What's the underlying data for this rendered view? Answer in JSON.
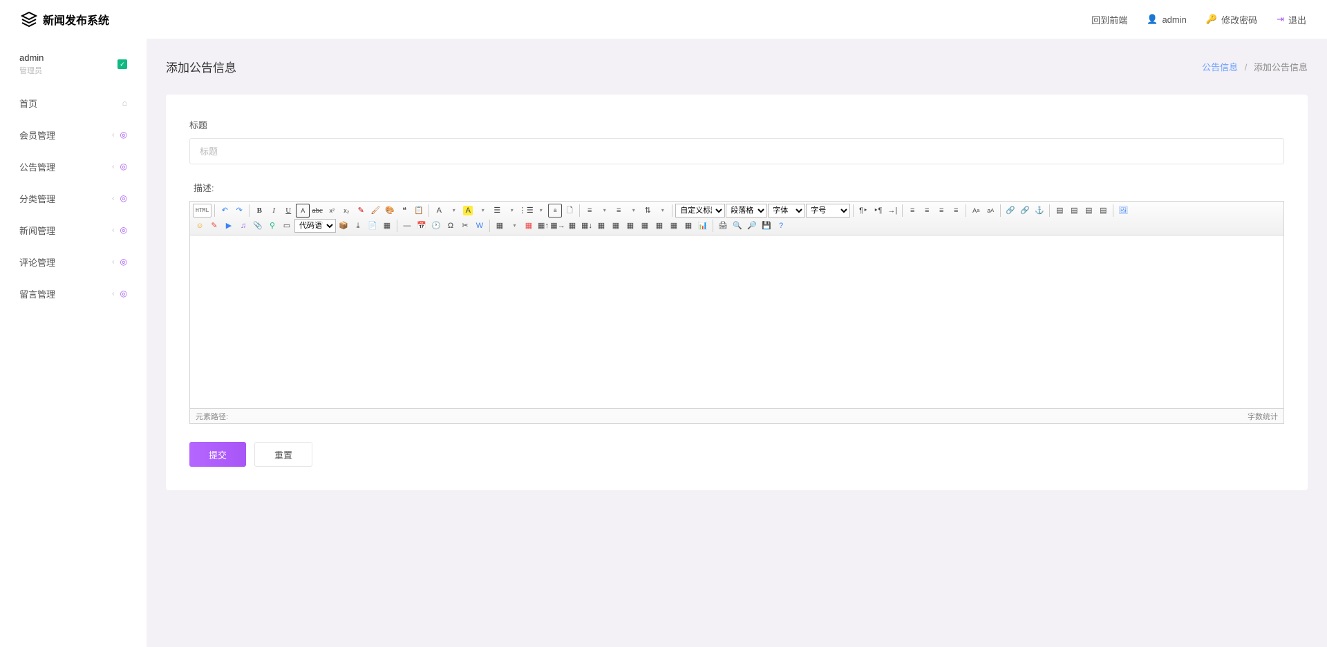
{
  "header": {
    "logo_text": "新闻发布系统",
    "links": {
      "frontend": "回到前端",
      "user": "admin",
      "change_pw": "修改密码",
      "logout": "退出"
    }
  },
  "sidebar": {
    "user": {
      "name": "admin",
      "role": "管理员"
    },
    "items": [
      {
        "label": "首页",
        "has_chev": false,
        "icon": "home"
      },
      {
        "label": "会员管理",
        "has_chev": true,
        "icon": "target"
      },
      {
        "label": "公告管理",
        "has_chev": true,
        "icon": "target"
      },
      {
        "label": "分类管理",
        "has_chev": true,
        "icon": "target"
      },
      {
        "label": "新闻管理",
        "has_chev": true,
        "icon": "target"
      },
      {
        "label": "评论管理",
        "has_chev": true,
        "icon": "target"
      },
      {
        "label": "留言管理",
        "has_chev": true,
        "icon": "target"
      }
    ]
  },
  "page": {
    "title": "添加公告信息",
    "breadcrumb": {
      "link": "公告信息",
      "current": "添加公告信息"
    }
  },
  "form": {
    "title_label": "标题",
    "title_placeholder": "标题",
    "desc_label": "描述:",
    "editor": {
      "selects": {
        "custom_title": "自定义标题",
        "para_format": "段落格式",
        "font": "字体",
        "size": "字号",
        "code_lang": "代码语言"
      },
      "html_btn": "HTML",
      "footer_path": "元素路径:",
      "footer_wc": "字数统计"
    },
    "submit": "提交",
    "reset": "重置"
  }
}
